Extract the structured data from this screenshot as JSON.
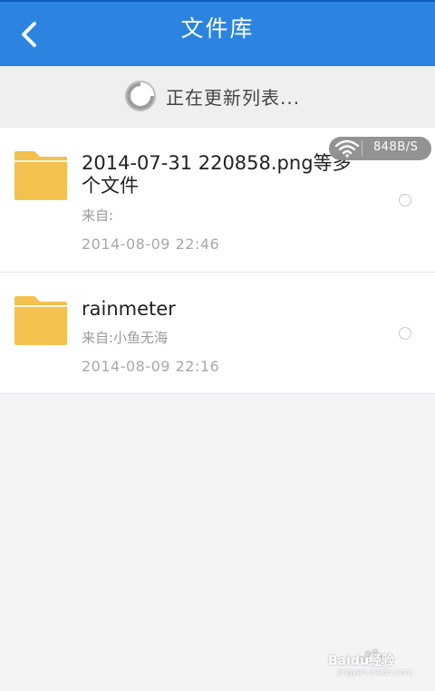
{
  "header": {
    "title": "文件库",
    "back_icon": "chevron-left-icon"
  },
  "status": {
    "text": "正在更新列表...",
    "icon": "loading-spinner-icon"
  },
  "speed_badge": {
    "icon": "wifi-icon",
    "value": "848B/S"
  },
  "files": [
    {
      "name": "2014-07-31 220858.png等多个文件",
      "from": "来自:",
      "date": "2014-08-09  22:46",
      "icon": "folder-icon"
    },
    {
      "name": "rainmeter",
      "from": "来自:小鱼无海",
      "date": "2014-08-09  22:16",
      "icon": "folder-icon"
    }
  ],
  "watermark": {
    "text": "Baidu经验",
    "sub": "jingyan.baidu.com"
  },
  "colors": {
    "header": "#2b84e0",
    "background": "#f3f4f6",
    "folder": "#f2c14e"
  }
}
